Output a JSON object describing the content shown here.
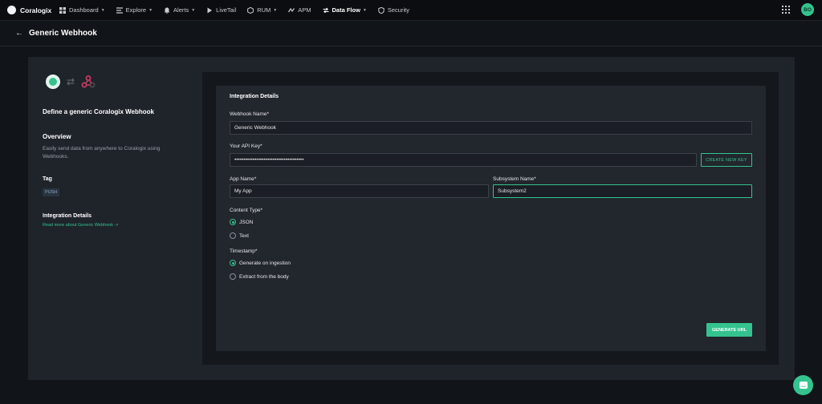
{
  "nav": {
    "brand": "Coralogix",
    "items": [
      {
        "label": "Dashboard",
        "icon": "dashboard-icon",
        "caret": true
      },
      {
        "label": "Explore",
        "icon": "explore-icon",
        "caret": true
      },
      {
        "label": "Alerts",
        "icon": "bell-icon",
        "caret": true
      },
      {
        "label": "LiveTail",
        "icon": "play-icon",
        "caret": false
      },
      {
        "label": "RUM",
        "icon": "rum-icon",
        "caret": true
      },
      {
        "label": "APM",
        "icon": "apm-icon",
        "caret": false
      },
      {
        "label": "Data Flow",
        "icon": "data-flow-icon",
        "caret": true
      },
      {
        "label": "Security",
        "icon": "shield-icon",
        "caret": false
      }
    ],
    "avatar": "BO"
  },
  "header": {
    "title": "Generic Webhook"
  },
  "info": {
    "define_title": "Define a generic Coralogix Webhook",
    "overview_heading": "Overview",
    "overview_text": "Easily send data from anywhere to Coralogix using Webhooks.",
    "tag_heading": "Tag",
    "tag": "PUSH",
    "integration_heading": "Integration Details",
    "read_more": "Read more about Generic Webhook ->"
  },
  "form": {
    "section_title": "Integration Details",
    "webhook_name_label": "Webhook Name*",
    "webhook_name_value": "Generic Webhook",
    "api_key_label": "Your API Key*",
    "api_key_value": "••••••••••••••••••••••••••••••••••••••",
    "create_key_label": "CREATE NEW KEY",
    "app_name_label": "App Name*",
    "app_name_value": "My App",
    "subsystem_label": "Subsystem Name*",
    "subsystem_value": "Subsystem2",
    "content_type_label": "Content Type*",
    "content_json": "JSON",
    "content_text": "Text",
    "timestamp_label": "Timestamp*",
    "timestamp_generate": "Generate on ingestion",
    "timestamp_extract": "Extract from the body",
    "generate_url_label": "GENERATE URL"
  },
  "colors": {
    "accent": "#34c38f",
    "background": "#111418",
    "panel": "#1f232a"
  }
}
